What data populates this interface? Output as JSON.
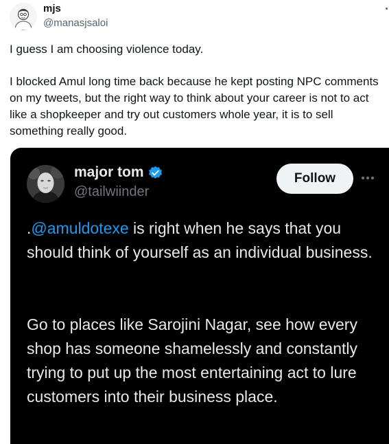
{
  "tweet": {
    "author": {
      "name": "mjs",
      "handle": "@manasjsaloi"
    },
    "text_line1": "I guess I am choosing violence today.",
    "text_para2": "I blocked Amul long time back because he kept posting NPC comments\non my tweets, but the right way to think about your career is not to act\nlike a shopkeeper and try out customers whole year, it is to sell\nsomething really good."
  },
  "quoted_screenshot": {
    "author": {
      "name": "major tom",
      "handle": "@tailwiinder",
      "verified": true
    },
    "follow_label": "Follow",
    "p1_prefix": ".",
    "p1_mention": "@amuldotexe",
    "p1_rest": " is right when he says that you should think of yourself as an individual business.",
    "p2": "Go to places like Sarojini Nagar, see how every shop has someone shamelessly and constantly trying to put up the most entertaining act to lure customers into their business place."
  },
  "colors": {
    "mention": "#1d9bf0",
    "verified_badge": "#1d9bf0",
    "dark_bg": "#000000",
    "handle_gray": "#536471"
  },
  "icons": {
    "avatar": "cartoon-person-avatar",
    "inner_avatar": "masked-face-avatar",
    "verified": "verified-badge-icon",
    "more": "more-options-icon"
  }
}
